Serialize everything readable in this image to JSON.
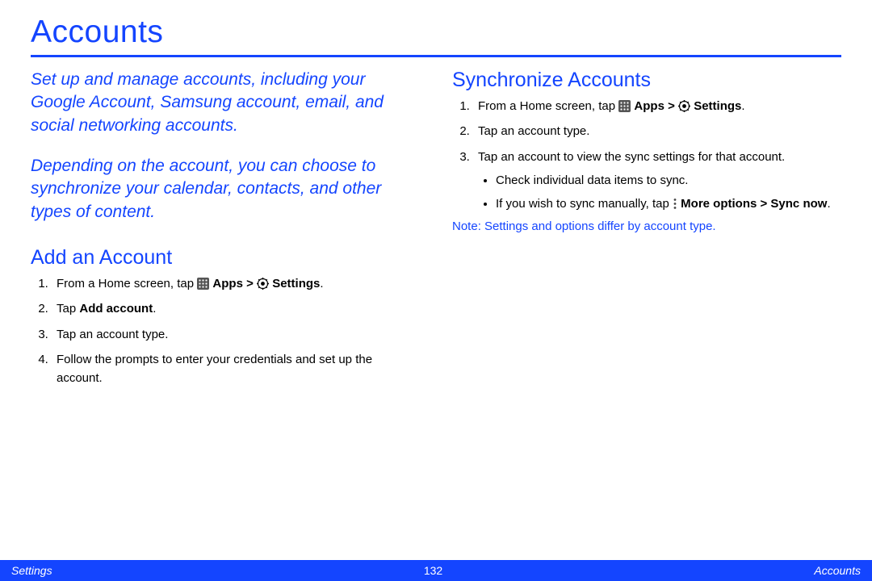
{
  "title": "Accounts",
  "intro": {
    "p1": "Set up and manage accounts, including your Google Account, Samsung account, email, and social networking accounts.",
    "p2": "Depending on the account, you can choose to synchronize your calendar, contacts, and other types of content."
  },
  "add": {
    "heading": "Add an Account",
    "s1_a": "From a Home screen, tap ",
    "s1_apps": "Apps > ",
    "s1_settings": "Settings",
    "s1_dot": ".",
    "s2_a": "Tap ",
    "s2_b": "Add account",
    "s2_c": ".",
    "s3": "Tap an account type.",
    "s4": "Follow the prompts to enter your credentials and set up the account."
  },
  "sync": {
    "heading": "Synchronize Accounts",
    "s1_a": "From a Home screen, tap ",
    "s1_apps": "Apps > ",
    "s1_settings": "Settings",
    "s1_dot": ".",
    "s2": "Tap an account type.",
    "s3": "Tap an account to view the sync settings for that account.",
    "b1": "Check individual data items to sync.",
    "b2_a": "If you wish to sync manually, tap ",
    "b2_b": "More options > Sync now",
    "b2_c": "."
  },
  "note": {
    "label": "Note",
    "text": ": Settings and options differ by account type."
  },
  "footer": {
    "left": "Settings",
    "page": "132",
    "right": "Accounts"
  },
  "icons": {
    "apps": "apps-grid-icon",
    "settings": "settings-gear-icon",
    "more": "more-options-icon"
  }
}
